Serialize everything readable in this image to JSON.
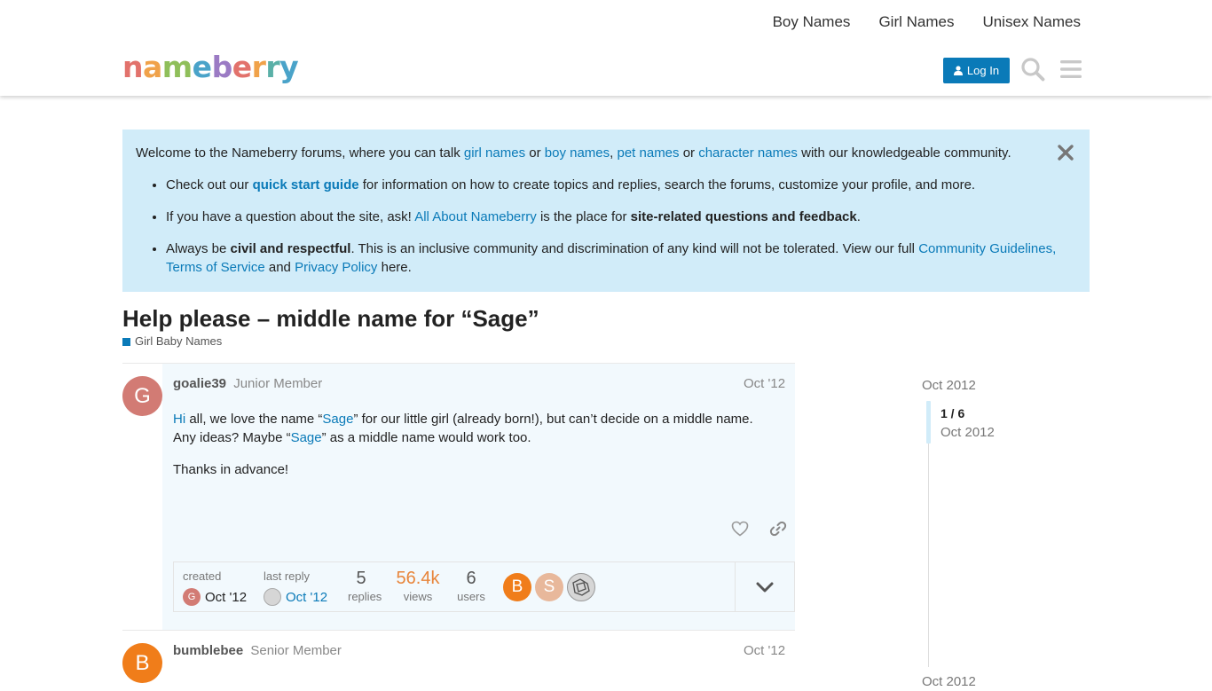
{
  "nav": {
    "links": [
      "Boy Names",
      "Girl Names",
      "Unisex Names"
    ]
  },
  "logo": {
    "parts": [
      "n",
      "a",
      "m",
      "e",
      "b",
      "e",
      "r",
      "r",
      "y"
    ]
  },
  "header": {
    "login_label": "Log In"
  },
  "banner": {
    "intro": {
      "pre": "Welcome to the Nameberry forums, where you can talk ",
      "l1": "girl names",
      "s1": " or ",
      "l2": "boy names",
      "s2": ", ",
      "l3": "pet names",
      "s3": " or ",
      "l4": "character names",
      "post": " with our knowledgeable community."
    },
    "b1": {
      "pre": "Check out our ",
      "link": "quick start guide",
      "post": " for information on how to create topics and replies, search the forums, customize your profile, and more."
    },
    "b2": {
      "pre": "If you have a question about the site, ask! ",
      "link": "All About Nameberry",
      "mid": " is the place for ",
      "bold": "site-related questions and feedback",
      "post": "."
    },
    "b3": {
      "pre": "Always be ",
      "bold": "civil and respectful",
      "mid": ". This is an inclusive community and discrimination of any kind will not be tolerated. View our full ",
      "l1": "Community Guidelines,",
      "s1": " ",
      "l2": "Terms of Service",
      "s2": " and ",
      "l3": "Privacy Policy",
      "post": " here."
    }
  },
  "topic": {
    "title": "Help please – middle name for “Sage”",
    "category": "Girl Baby Names",
    "category_color": "#0a7ab8"
  },
  "posts": [
    {
      "avatar_letter": "G",
      "avatar_color": "#d27b74",
      "username": "goalie39",
      "user_title": "Junior Member",
      "date": "Oct '12",
      "body": {
        "p1_l1": "Hi",
        "p1_t1": " all, we love the name “",
        "p1_l2": "Sage",
        "p1_t2": "” for our little girl (already born!), but can’t decide on a middle name. Any ideas? Maybe “",
        "p1_l3": "Sage",
        "p1_t3": "” as a middle name would work too.",
        "p2": "Thanks in advance!"
      }
    },
    {
      "avatar_letter": "B",
      "avatar_color": "#f07d1a",
      "username": "bumblebee",
      "user_title": "Senior Member",
      "date": "Oct '12"
    }
  ],
  "topic_map": {
    "created_label": "created",
    "created_date": "Oct '12",
    "created_avatar": "G",
    "last_reply_label": "last reply",
    "last_reply_date": "Oct '12",
    "replies": "5",
    "replies_label": "replies",
    "views": "56.4k",
    "views_label": "views",
    "users": "6",
    "users_label": "users",
    "participants": [
      {
        "letter": "B",
        "color": "#f07d1a"
      },
      {
        "letter": "S",
        "color": "#e8b89b"
      },
      {
        "letter": "",
        "color": "#bdbdbd"
      }
    ]
  },
  "timeline": {
    "start": "Oct 2012",
    "position": "1 / 6",
    "position_date": "Oct 2012",
    "end": "Oct 2012"
  }
}
